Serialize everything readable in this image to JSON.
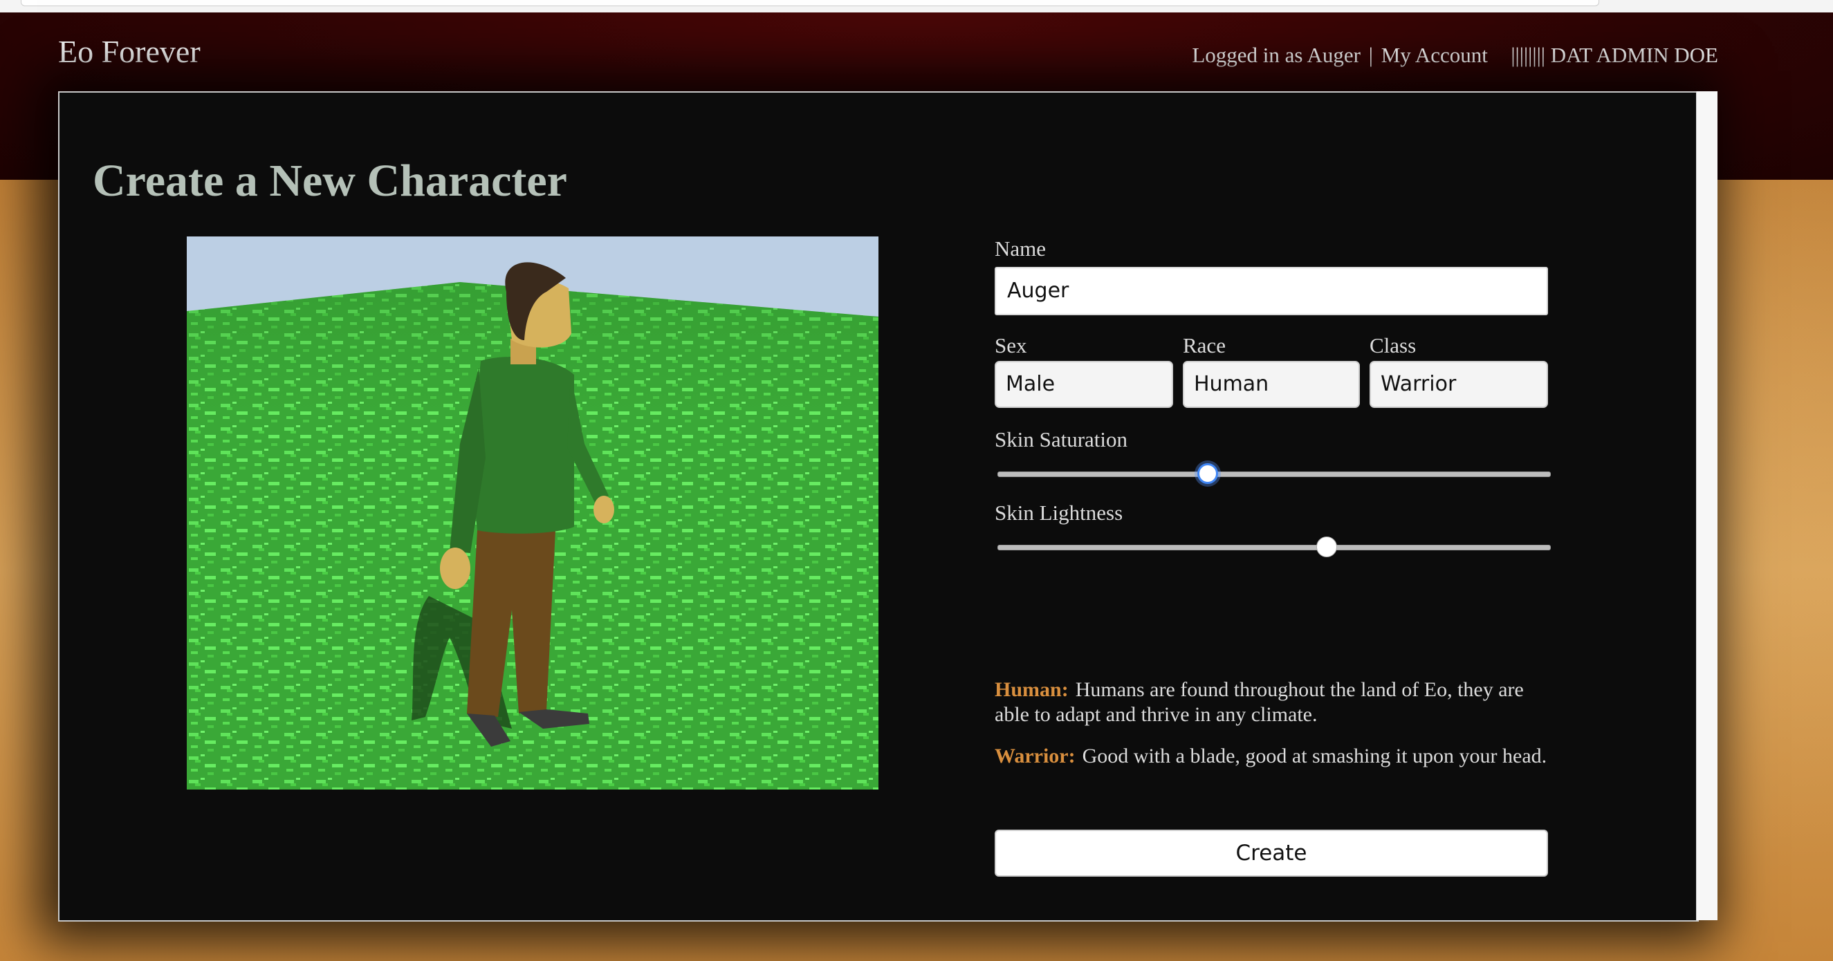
{
  "header": {
    "site_title": "Eo Forever",
    "logged_in_text": "Logged in as Auger",
    "separator": "|",
    "my_account": "My Account",
    "admin_label": "|||||||| DAT ADMIN DOE"
  },
  "main": {
    "page_title": "Create a New Character"
  },
  "form": {
    "name_label": "Name",
    "name_value": "Auger",
    "sex_label": "Sex",
    "sex_value": "Male",
    "race_label": "Race",
    "race_value": "Human",
    "class_label": "Class",
    "class_value": "Warrior",
    "skin_saturation_label": "Skin Saturation",
    "skin_saturation_value": 0.38,
    "skin_lightness_label": "Skin Lightness",
    "skin_lightness_value": 0.595,
    "race_desc_name": "Human:",
    "race_desc_text": "Humans are found throughout the land of Eo, they are able to adapt and thrive in any climate.",
    "class_desc_name": "Warrior:",
    "class_desc_text": "Good with a blade, good at smashing it upon your head.",
    "create_label": "Create"
  },
  "colors": {
    "accent": "#d98f3e",
    "header_bg": "#2d0404",
    "panel_bg": "#0c0c0c",
    "title_color": "#b5c1b8"
  }
}
